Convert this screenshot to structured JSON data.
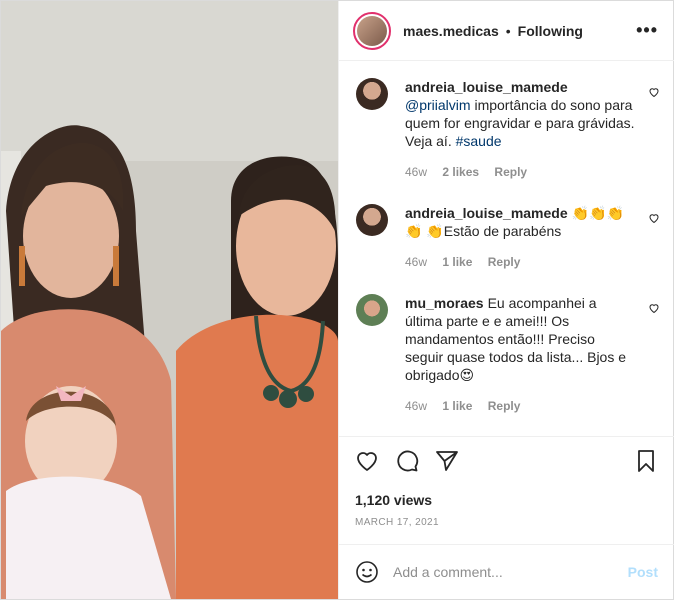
{
  "header": {
    "username": "maes.medicas",
    "separator": "•",
    "following_label": "Following",
    "more_icon": "more-horizontal-icon"
  },
  "comments": [
    {
      "username": "andreia_louise_mamede",
      "mention": "@priialvim",
      "text": " importância do sono para quem for engravidar e para grávidas. Veja aí. ",
      "hashtag": "#saude",
      "age": "46w",
      "likes": "2 likes",
      "reply": "Reply"
    },
    {
      "username": "andreia_louise_mamede",
      "text": "👏👏👏👏 👏Estão de parabéns",
      "age": "46w",
      "likes": "1 like",
      "reply": "Reply"
    },
    {
      "username": "mu_moraes",
      "text": "Eu acompanhei a última parte e e amei!!! Os mandamentos então!!! Preciso seguir quase todos da lista... Bjos e obrigado😍",
      "age": "46w",
      "likes": "1 like",
      "reply": "Reply"
    }
  ],
  "actions": {
    "like_icon": "heart-icon",
    "comment_icon": "comment-icon",
    "share_icon": "paper-plane-icon",
    "save_icon": "bookmark-icon"
  },
  "stats": {
    "views": "1,120 views",
    "date": "MARCH 17, 2021"
  },
  "add_comment": {
    "placeholder": "Add a comment...",
    "post_label": "Post",
    "emoji_icon": "smiley-icon"
  },
  "colors": {
    "link": "#00376b",
    "muted": "#8e8e8e",
    "post_disabled": "#b2dffc"
  }
}
